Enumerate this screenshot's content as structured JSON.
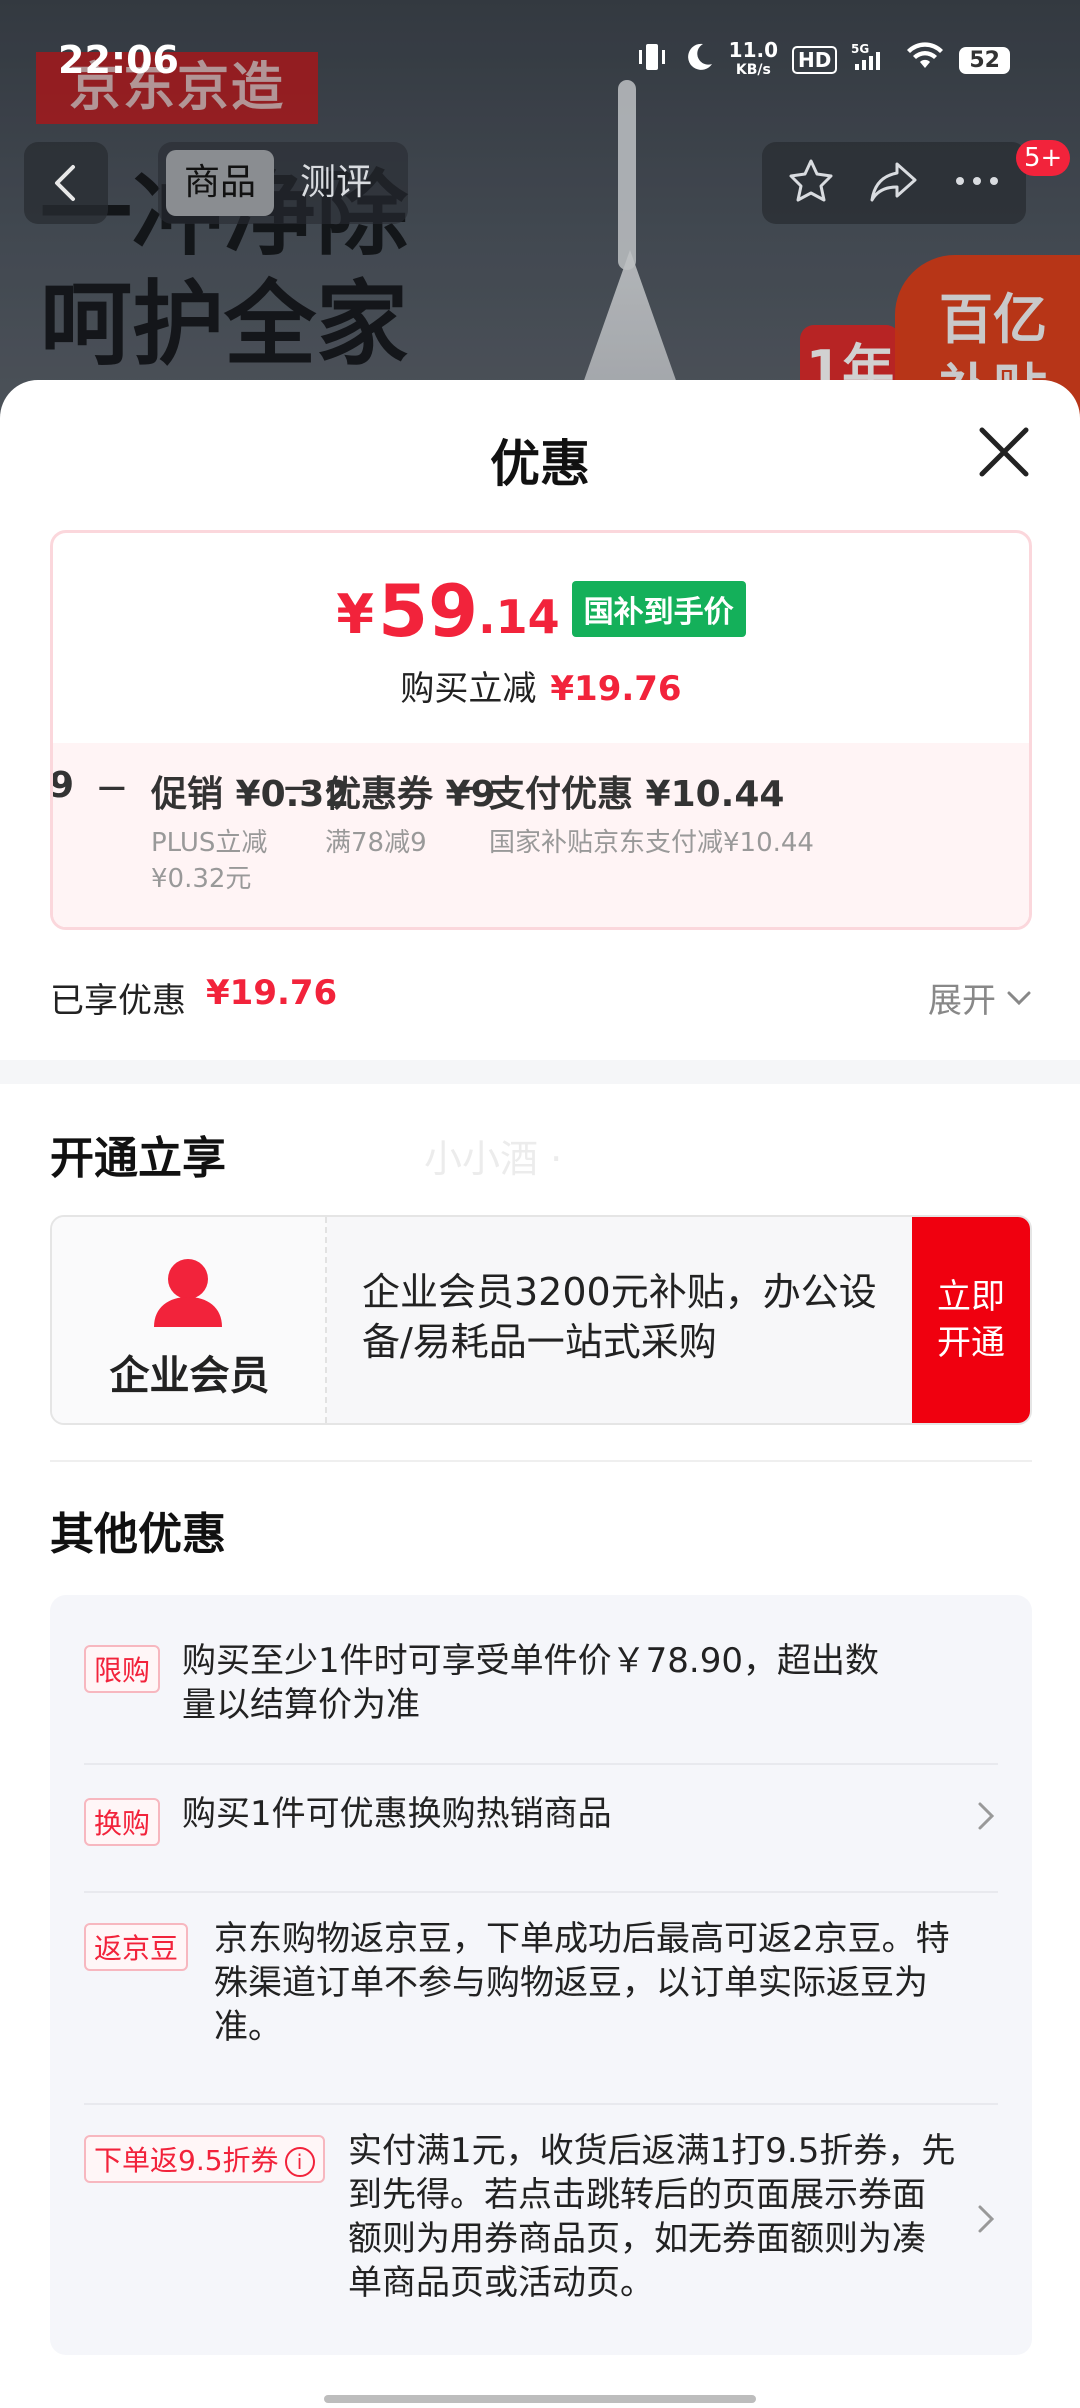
{
  "status_bar": {
    "time": "22:06",
    "net_speed_value": "11.0",
    "net_speed_unit": "KB/s",
    "hd": "HD",
    "network": "5G",
    "battery": "52"
  },
  "nav": {
    "tab_product": "商品",
    "tab_review": "测评",
    "badge": "5+"
  },
  "background": {
    "brand": "京东京造",
    "slogan_line1": "一冲净除",
    "slogan_line2": "呵护全家",
    "badge_text": "百亿补贴",
    "badge2_text": "1年"
  },
  "sheet": {
    "title": "优惠",
    "price": {
      "currency": "¥",
      "integer": "59",
      "decimal": ".14",
      "tag": "国补到手价",
      "save_label": "购买立减",
      "save_value": "¥19.76"
    },
    "breakdown": [
      {
        "title": "9",
        "sub": ""
      },
      {
        "title": "促销 ¥0.32",
        "sub": "PLUS立减",
        "sub2": "¥0.32元"
      },
      {
        "title": "优惠券 ¥9",
        "sub": "满78减9"
      },
      {
        "title": "支付优惠 ¥10.44",
        "sub": "国家补贴京东支付减¥10.44"
      }
    ],
    "enjoyed_label": "已享优惠",
    "enjoyed_value": "¥19.76",
    "expand_label": "展开",
    "open_section": {
      "title": "开通立享",
      "watermark": "小小酒 ·",
      "member_name": "企业会员",
      "member_desc": "企业会员3200元补贴，办公设备/易耗品一站式采购",
      "button": "立即开通",
      "accent_color": "#f0000f"
    },
    "other_section": {
      "title": "其他优惠",
      "items": [
        {
          "tag": "限购",
          "text": "购买至少1件时可享受单件价￥78.90，超出数量以结算价为准",
          "has_arrow": false
        },
        {
          "tag": "换购",
          "text": "购买1件可优惠换购热销商品",
          "has_arrow": true
        },
        {
          "tag": "返京豆",
          "text": "京东购物返京豆，下单成功后最高可返2京豆。特殊渠道订单不参与购物返豆，以订单实际返豆为准。",
          "has_arrow": false
        },
        {
          "tag": "下单返9.5折券",
          "text": "实付满1元，收货后返满1打9.5折券，先到先得。若点击跳转后的页面展示券面额则为用券商品页，如无券面额则为凑单商品页或活动页。",
          "has_arrow": true
        }
      ]
    }
  },
  "colors": {
    "accent_red": "#f2233b",
    "price_tag_green": "#14b05a"
  }
}
